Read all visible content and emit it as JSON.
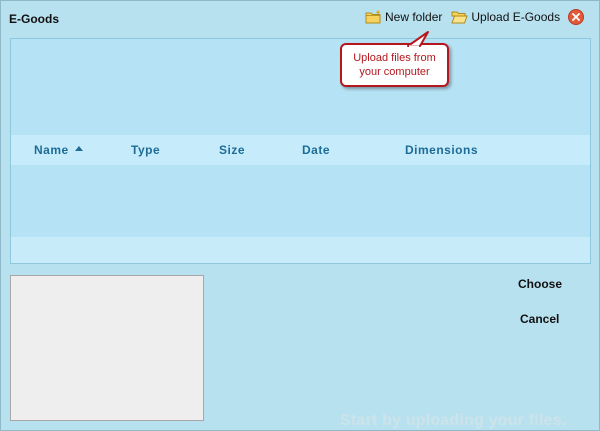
{
  "window": {
    "title": "E-Goods"
  },
  "toolbar": {
    "new_folder_label": "New folder",
    "upload_label": "Upload E-Goods",
    "close_icon": "close-icon"
  },
  "tooltip": {
    "line1": "Upload files from",
    "line2": "your computer"
  },
  "table": {
    "columns": [
      "Name",
      "Type",
      "Size",
      "Date",
      "Dimensions"
    ],
    "sorted_column": "Name",
    "sort_direction": "ascending"
  },
  "actions": {
    "choose_label": "Choose",
    "cancel_label": "Cancel"
  },
  "status": {
    "hint": "Start by uploading your files."
  },
  "colors": {
    "background": "#b8e1f0",
    "header_text": "#1e6c96",
    "tooltip_border": "#b5171e",
    "close_button": "#e05a3a"
  }
}
